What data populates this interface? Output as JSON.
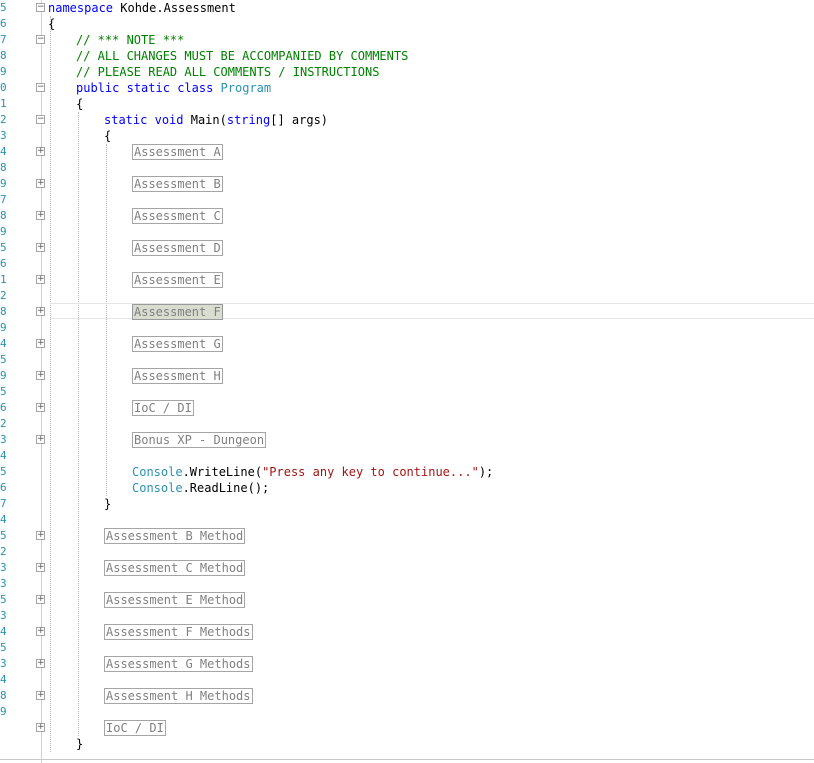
{
  "editor": {
    "line_numbers": [
      "5",
      "6",
      "7",
      "8",
      "9",
      "0",
      "1",
      "2",
      "3",
      "4",
      "8",
      "9",
      "7",
      "8",
      "9",
      "5",
      "6",
      "1",
      "2",
      "8",
      "9",
      "4",
      "5",
      "9",
      "5",
      "6",
      "2",
      "3",
      "4",
      "5",
      "6",
      "7",
      "4",
      "5",
      "2",
      "3",
      "3",
      "5",
      "3",
      "4",
      "5",
      "3",
      "4",
      "8",
      "9"
    ],
    "lines": [
      {
        "tokens": [
          {
            "t": "kw",
            "v": "namespace"
          },
          {
            "t": "plain",
            "v": " Kohde.Assessment"
          }
        ]
      },
      {
        "tokens": [
          {
            "t": "plain",
            "v": "{"
          }
        ]
      },
      {
        "tokens": [
          {
            "t": "cm",
            "v": "// *** NOTE ***"
          }
        ]
      },
      {
        "tokens": [
          {
            "t": "cm",
            "v": "// ALL CHANGES MUST BE ACCOMPANIED BY COMMENTS"
          }
        ]
      },
      {
        "tokens": [
          {
            "t": "cm",
            "v": "// PLEASE READ ALL COMMENTS / INSTRUCTIONS"
          }
        ]
      },
      {
        "tokens": [
          {
            "t": "kw",
            "v": "public"
          },
          {
            "t": "plain",
            "v": " "
          },
          {
            "t": "kw",
            "v": "static"
          },
          {
            "t": "plain",
            "v": " "
          },
          {
            "t": "kw",
            "v": "class"
          },
          {
            "t": "plain",
            "v": " "
          },
          {
            "t": "ty",
            "v": "Program"
          }
        ]
      },
      {
        "tokens": [
          {
            "t": "plain",
            "v": "{"
          }
        ]
      },
      {
        "tokens": [
          {
            "t": "kw",
            "v": "static"
          },
          {
            "t": "plain",
            "v": " "
          },
          {
            "t": "kw",
            "v": "void"
          },
          {
            "t": "plain",
            "v": " Main("
          },
          {
            "t": "kw",
            "v": "string"
          },
          {
            "t": "plain",
            "v": "[] args)"
          }
        ]
      },
      {
        "tokens": [
          {
            "t": "plain",
            "v": "{"
          }
        ]
      },
      {
        "region": "Assessment A"
      },
      {
        "blank": true
      },
      {
        "region": "Assessment B"
      },
      {
        "blank": true
      },
      {
        "region": "Assessment C"
      },
      {
        "blank": true
      },
      {
        "region": "Assessment D"
      },
      {
        "blank": true
      },
      {
        "region": "Assessment E"
      },
      {
        "blank": true
      },
      {
        "region": "Assessment F",
        "selected": true
      },
      {
        "blank": true
      },
      {
        "region": "Assessment G"
      },
      {
        "blank": true
      },
      {
        "region": "Assessment H"
      },
      {
        "blank": true
      },
      {
        "region": "IoC / DI"
      },
      {
        "blank": true
      },
      {
        "region": "Bonus XP - Dungeon"
      },
      {
        "blank": true
      },
      {
        "tokens": [
          {
            "t": "ty",
            "v": "Console"
          },
          {
            "t": "plain",
            "v": ".WriteLine("
          },
          {
            "t": "str",
            "v": "\"Press any key to continue...\""
          },
          {
            "t": "plain",
            "v": ");"
          }
        ]
      },
      {
        "tokens": [
          {
            "t": "ty",
            "v": "Console"
          },
          {
            "t": "plain",
            "v": ".ReadLine();"
          }
        ]
      },
      {
        "tokens": [
          {
            "t": "plain",
            "v": "}"
          }
        ]
      },
      {
        "blank": true
      },
      {
        "region": "Assessment B Method"
      },
      {
        "blank": true
      },
      {
        "region": "Assessment C Method"
      },
      {
        "blank": true
      },
      {
        "region": "Assessment E Method"
      },
      {
        "blank": true
      },
      {
        "region": "Assessment F Methods"
      },
      {
        "blank": true
      },
      {
        "region": "Assessment G Methods"
      },
      {
        "blank": true
      },
      {
        "region": "Assessment H Methods"
      },
      {
        "blank": true
      },
      {
        "region": "IoC / DI"
      },
      {
        "tokens": [
          {
            "t": "plain",
            "v": "}"
          }
        ]
      }
    ]
  },
  "colors": {
    "keyword": "#0000ff",
    "comment": "#008000",
    "type": "#2b91af",
    "string": "#a31515",
    "line_number": "#2b91af",
    "region_text": "#808080",
    "selected_region_bg": "#d9ddd0"
  }
}
